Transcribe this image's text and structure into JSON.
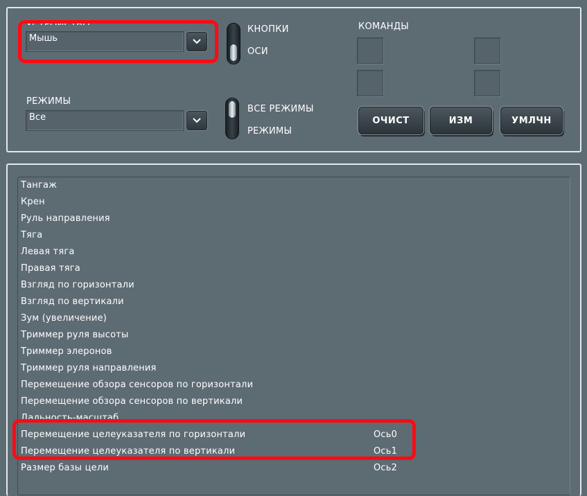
{
  "device": {
    "label": "УСТРОЙСТВО",
    "selected": "Мышь"
  },
  "modes": {
    "label": "РЕЖИМЫ",
    "selected": "Все"
  },
  "toggle_type": {
    "option_top": "КНОПКИ",
    "option_bottom": "ОСИ",
    "value": "ОСИ"
  },
  "toggle_modes": {
    "option_top": "ВСЕ РЕЖИМЫ",
    "option_bottom": "РЕЖИМЫ",
    "value": "ВСЕ РЕЖИМЫ"
  },
  "commands": {
    "label": "КОМАНДЫ",
    "clear": "ОЧИСТ",
    "change": "ИЗМ",
    "default": "УМЛЧН"
  },
  "rows": [
    {
      "name": "Тангаж",
      "axis": ""
    },
    {
      "name": "Крен",
      "axis": ""
    },
    {
      "name": "Руль направления",
      "axis": ""
    },
    {
      "name": "Тяга",
      "axis": ""
    },
    {
      "name": "Левая тяга",
      "axis": ""
    },
    {
      "name": "Правая тяга",
      "axis": ""
    },
    {
      "name": "Взгляд по горизонтали",
      "axis": ""
    },
    {
      "name": "Взгляд по вертикали",
      "axis": ""
    },
    {
      "name": "Зум (увеличение)",
      "axis": ""
    },
    {
      "name": "Триммер руля высоты",
      "axis": ""
    },
    {
      "name": "Триммер элеронов",
      "axis": ""
    },
    {
      "name": "Триммер руля направления",
      "axis": ""
    },
    {
      "name": "Перемещение обзора сенсоров по горизонтали",
      "axis": ""
    },
    {
      "name": "Перемещение обзора сенсоров по вертикали",
      "axis": ""
    },
    {
      "name": "Дальность-масштаб",
      "axis": ""
    },
    {
      "name": "Перемещение целеуказателя по горизонтали",
      "axis": "Ось0"
    },
    {
      "name": "Перемещение целеуказателя по вертикали",
      "axis": "Ось1"
    },
    {
      "name": "Размер базы цели",
      "axis": "Ось2"
    }
  ],
  "colors": {
    "background": "#5d6b73",
    "highlight": "#ff0a14",
    "frame": "#e4e8ea"
  },
  "icons": {
    "dropdown": "chevron-down-icon"
  }
}
